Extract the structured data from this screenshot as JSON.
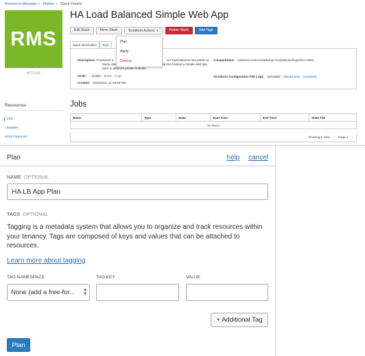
{
  "breadcrumb": [
    "Resource Manager",
    "Stacks",
    "Stack Details"
  ],
  "logo_text": "RMS",
  "state": "ACTIVE",
  "stack_title": "HA Load Balanced Simple Web App",
  "actions": {
    "edit": "Edit Stack",
    "move": "Move Stack",
    "terraform": "Terraform Actions",
    "delete": "Delete Stack",
    "add_tags": "Add Tags"
  },
  "terraform_menu": [
    "Plan",
    "Apply",
    "Destroy"
  ],
  "info_tabs": [
    "Stack Information",
    "Tags"
  ],
  "info": {
    "description_label": "Description:",
    "description_line1": "Provisions a",
    "description_line1b": "ver load balancer into public su",
    "description_line2": "bnets distributing load across 2 compute instances hosting a simple web app",
    "description_line3": "each in different private subnets",
    "ocid_label": "OCID:",
    "ocid_value": "...3cidba",
    "show": "Show",
    "copy": "Copy",
    "created_label": "Created:",
    "created_value": "5/21/2019, 11:48:58 PM",
    "compartment_label": "Compartment:",
    "compartment_value": "orasesenorseecowarkshop (root)/Workshops/OCI-ORM",
    "tf_config_label": "Terraform Configuration File (.zip):",
    "tf_config_value": "Uploaded",
    "upload_new": "Upload New",
    "download": "Download"
  },
  "resources": {
    "title": "Resources",
    "items": [
      "Jobs",
      "Variables",
      "Work Requests"
    ]
  },
  "jobs": {
    "title": "Jobs",
    "columns": [
      "Name",
      "Type",
      "State",
      "Start Time",
      "End Time",
      "State File"
    ],
    "empty": "No items",
    "showing": "Showing 0 Jobs",
    "page": "Page 1",
    "prev": "‹",
    "next": "›"
  },
  "plan_panel": {
    "title": "Plan",
    "help": "help",
    "cancel": "cancel",
    "name_label": "NAME",
    "optional": "OPTIONAL",
    "name_value": "HA LB App Plan",
    "tags_label": "TAGS",
    "tags_desc": "Tagging is a metadata system that allows you to organize and track resources within your tenancy. Tags are composed of keys and values that can be attached to resources.",
    "learn_more": "Learn more about tagging",
    "tag_namespace_label": "TAG NAMESPACE",
    "tag_key_label": "TAG KEY",
    "value_label": "VALUE",
    "namespace_value": "None (add a free-for...",
    "additional_tag": "+ Additional Tag",
    "plan_button": "Plan"
  }
}
